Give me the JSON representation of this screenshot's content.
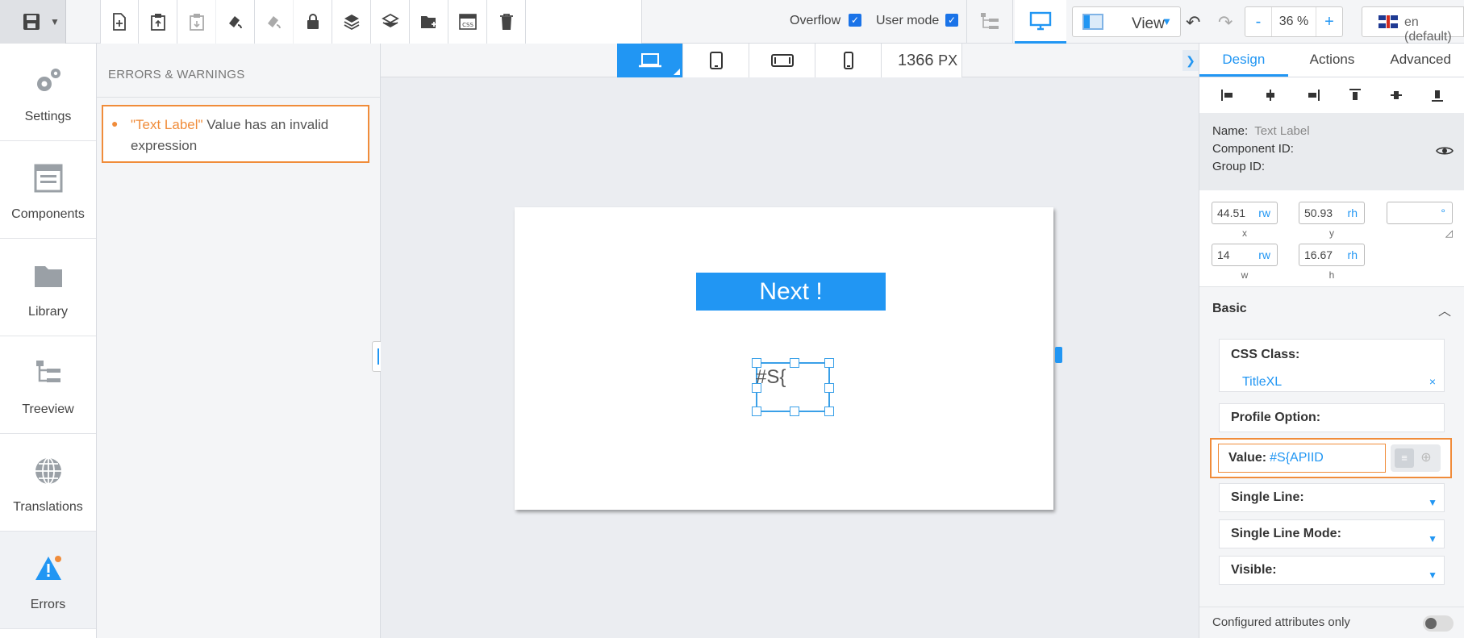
{
  "toolbar": {
    "overflow_label": "Overflow",
    "overflow_checked": true,
    "usermode_label": "User mode",
    "usermode_checked": true,
    "view_label": "View",
    "zoom_minus": "-",
    "zoom_value": "36 %",
    "zoom_plus": "+",
    "language": "en (default)",
    "icons": [
      "save-icon",
      "new-page-icon",
      "paste-icon",
      "paste-disabled-icon",
      "format-paint-icon",
      "format-paint-disabled-icon",
      "lock-icon",
      "layers-icon",
      "layers-alt-icon",
      "new-folder-icon",
      "css-icon",
      "delete-icon"
    ]
  },
  "leftnav": {
    "items": [
      {
        "label": "Settings",
        "icon": "gears-icon"
      },
      {
        "label": "Components",
        "icon": "components-icon"
      },
      {
        "label": "Library",
        "icon": "folder-icon"
      },
      {
        "label": "Treeview",
        "icon": "treeview-icon"
      },
      {
        "label": "Translations",
        "icon": "globe-icon"
      },
      {
        "label": "Errors",
        "icon": "warning-icon"
      }
    ]
  },
  "errors": {
    "heading": "ERRORS & WARNINGS",
    "items": [
      {
        "component": "\"Text Label\"",
        "message": " Value has an invalid expression"
      }
    ]
  },
  "canvas": {
    "device_px": "1366",
    "px_unit": "PX",
    "button_label": "Next !",
    "selected_text": "#S{"
  },
  "rightpanel": {
    "tabs": [
      "Design",
      "Actions",
      "Advanced"
    ],
    "name_label": "Name:",
    "name_value": "Text Label",
    "component_id_label": "Component ID:",
    "group_id_label": "Group ID:",
    "geometry": {
      "x": "44.51",
      "x_unit": "rw",
      "x_label": "x",
      "y": "50.93",
      "y_unit": "rh",
      "y_label": "y",
      "w": "14",
      "w_unit": "rw",
      "w_label": "w",
      "h": "16.67",
      "h_unit": "rh",
      "h_label": "h"
    },
    "section_basic": "Basic",
    "css_class_label": "CSS Class:",
    "css_class_value": "TitleXL",
    "css_class_clear": "×",
    "profile_option_label": "Profile Option:",
    "value_label": "Value:",
    "value_value": "#S{APIID",
    "single_line_label": "Single Line:",
    "single_line_mode_label": "Single Line Mode:",
    "visible_label": "Visible:",
    "configured_only_label": "Configured attributes only"
  },
  "colors": {
    "accent": "#2196f3",
    "error": "#f08c3a"
  }
}
